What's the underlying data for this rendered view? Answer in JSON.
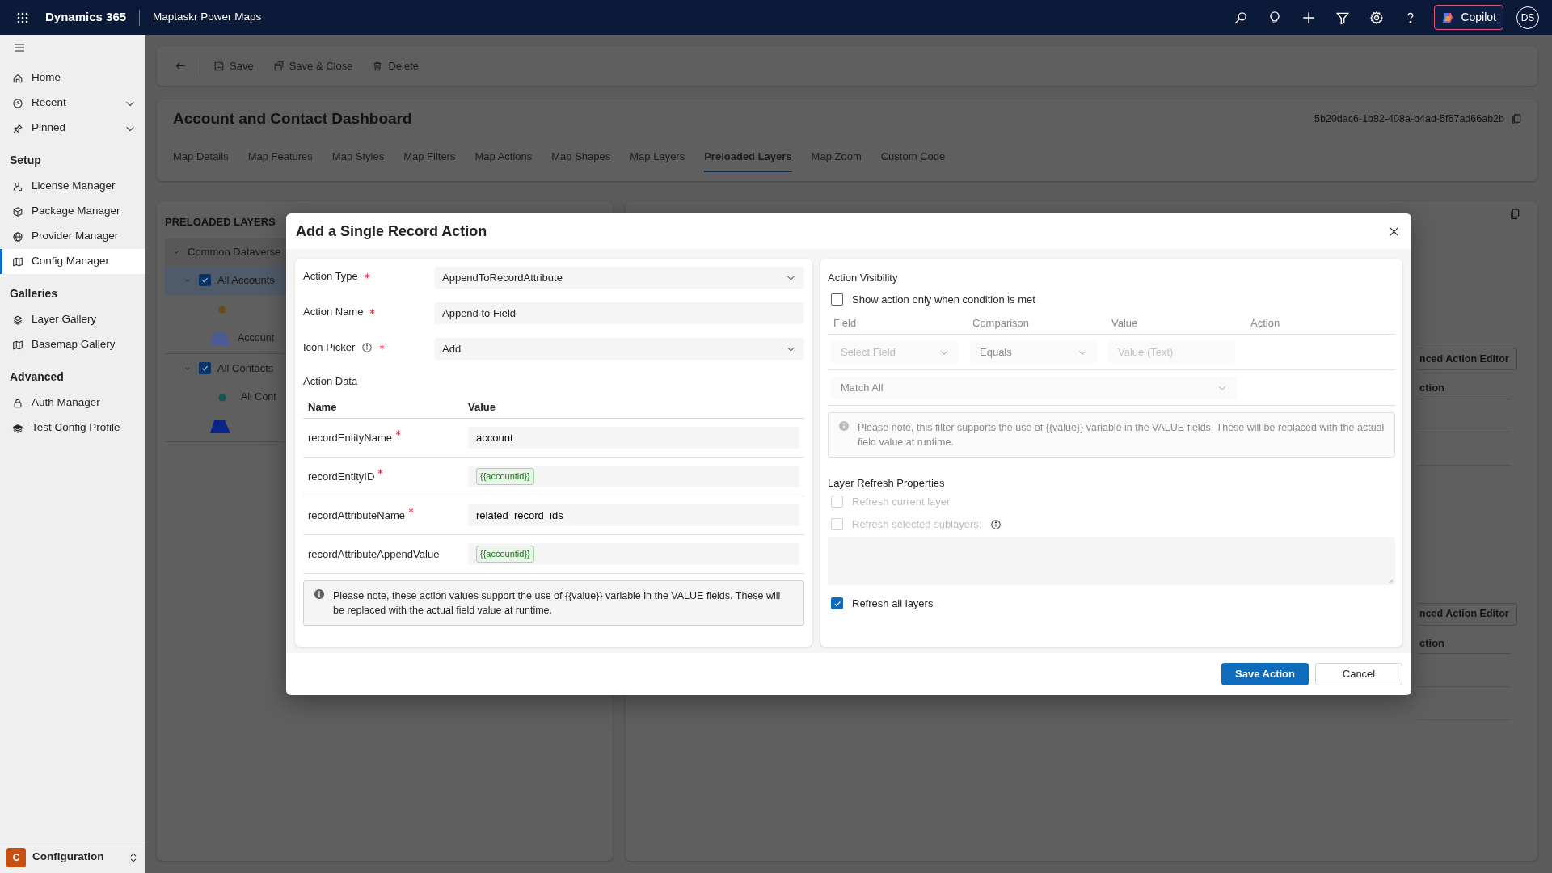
{
  "top_bar": {
    "app_name": "Dynamics 365",
    "app_title": "Maptaskr Power Maps",
    "copilot": "Copilot",
    "avatar": "DS"
  },
  "sidebar": {
    "sections": [
      {
        "items": [
          {
            "label": "Home",
            "kind": "link",
            "selected": false
          },
          {
            "label": "Recent",
            "kind": "menu",
            "selected": false
          },
          {
            "label": "Pinned",
            "kind": "menu",
            "selected": false
          }
        ]
      },
      {
        "title": "Setup",
        "items": [
          {
            "label": "License Manager",
            "kind": "link",
            "selected": false
          },
          {
            "label": "Package Manager",
            "kind": "link",
            "selected": false
          },
          {
            "label": "Provider Manager",
            "kind": "link",
            "selected": false
          },
          {
            "label": "Config Manager",
            "kind": "link",
            "selected": true
          }
        ]
      },
      {
        "title": "Galleries",
        "items": [
          {
            "label": "Layer Gallery",
            "kind": "link",
            "selected": false
          },
          {
            "label": "Basemap Gallery",
            "kind": "link",
            "selected": false
          }
        ]
      },
      {
        "title": "Advanced",
        "items": [
          {
            "label": "Auth Manager",
            "kind": "link",
            "selected": false
          },
          {
            "label": "Test Config Profile",
            "kind": "link",
            "selected": false
          }
        ]
      }
    ],
    "area_switcher": {
      "letter": "C",
      "label": "Configuration"
    }
  },
  "command_bar": {
    "buttons": [
      {
        "label": "Save"
      },
      {
        "label": "Save & Close"
      },
      {
        "label": "Delete"
      }
    ]
  },
  "header": {
    "title": "Account and Contact Dashboard",
    "record_id": "5b20dac6-1b82-408a-b4ad-5f67ad66ab2b",
    "tabs": [
      {
        "label": "Map Details",
        "selected": false
      },
      {
        "label": "Map Features",
        "selected": false
      },
      {
        "label": "Map Styles",
        "selected": false
      },
      {
        "label": "Map Filters",
        "selected": false
      },
      {
        "label": "Map Actions",
        "selected": false
      },
      {
        "label": "Map Shapes",
        "selected": false
      },
      {
        "label": "Map Layers",
        "selected": false
      },
      {
        "label": "Preloaded Layers",
        "selected": true
      },
      {
        "label": "Map Zoom",
        "selected": false
      },
      {
        "label": "Custom Code",
        "selected": false
      }
    ]
  },
  "layers_panel": {
    "title": "PRELOADED LAYERS",
    "tree": [
      {
        "label": "Common Dataverse",
        "expanded": true,
        "children": [
          {
            "label": "All Accounts",
            "checked": true,
            "expanded": true,
            "selected": true,
            "children": [
              {
                "kind": "point",
                "color": "#6b4c0e"
              },
              {
                "kind": "polygon",
                "color": "#4d5b94",
                "label": "Account"
              }
            ]
          },
          {
            "label": "All Contacts",
            "checked": true,
            "expanded": true,
            "selected": false,
            "children": [
              {
                "kind": "point",
                "color": "#0f5757",
                "label": "All Cont"
              },
              {
                "kind": "polygon",
                "color": "#0b2488"
              }
            ]
          }
        ]
      }
    ]
  },
  "detail_panel": {
    "sections": [
      {
        "button": "nced Action Editor",
        "column_header": "ction"
      },
      {
        "button": "nced Action Editor",
        "column_header": "ction"
      }
    ]
  },
  "dialog": {
    "title": "Add a Single Record Action",
    "fields": [
      {
        "label": "Action Type",
        "required": true,
        "info": false,
        "kind": "select",
        "value": "AppendToRecordAttribute"
      },
      {
        "label": "Action Name",
        "required": true,
        "info": false,
        "kind": "text",
        "value": "Append to Field"
      },
      {
        "label": "Icon Picker",
        "required": true,
        "info": true,
        "kind": "select",
        "value": "Add"
      }
    ],
    "action_data": {
      "title": "Action Data",
      "columns": [
        "Name",
        "Value"
      ],
      "rows": [
        {
          "name": "recordEntityName",
          "required": true,
          "kind": "text",
          "value": "account"
        },
        {
          "name": "recordEntityID",
          "required": true,
          "kind": "token",
          "value": "{{accountid}}"
        },
        {
          "name": "recordAttributeName",
          "required": true,
          "kind": "text",
          "value": "related_record_ids"
        },
        {
          "name": "recordAttributeAppendValue",
          "required": false,
          "kind": "token",
          "value": "{{accountid}}"
        }
      ],
      "note": "Please note, these action values support the use of {{value}} variable in the VALUE fields. These will be replaced with the actual field value at runtime."
    },
    "visibility": {
      "title": "Action Visibility",
      "condition": {
        "label": "Show action only when condition is met",
        "checked": false
      },
      "columns": [
        "Field",
        "Comparison",
        "Value",
        "Action"
      ],
      "field_placeholder": "Select Field",
      "comparison": "Equals",
      "value_placeholder": "Value (Text)",
      "match": "Match All",
      "note": "Please note, this filter supports the use of {{value}} variable in the VALUE fields. These will be replaced with the actual field value at runtime."
    },
    "refresh": {
      "title": "Layer Refresh Properties",
      "options": [
        {
          "label": "Refresh current layer",
          "kind": "plain",
          "checked": false,
          "disabled": true
        },
        {
          "label": "Refresh selected sublayers:",
          "kind": "sublayers",
          "checked": false,
          "disabled": true
        },
        {
          "label": "Refresh all layers",
          "kind": "plain",
          "checked": true,
          "disabled": false
        }
      ]
    },
    "buttons": [
      {
        "label": "Save Action",
        "kind": "primary"
      },
      {
        "label": "Cancel",
        "kind": "secondary"
      }
    ]
  }
}
